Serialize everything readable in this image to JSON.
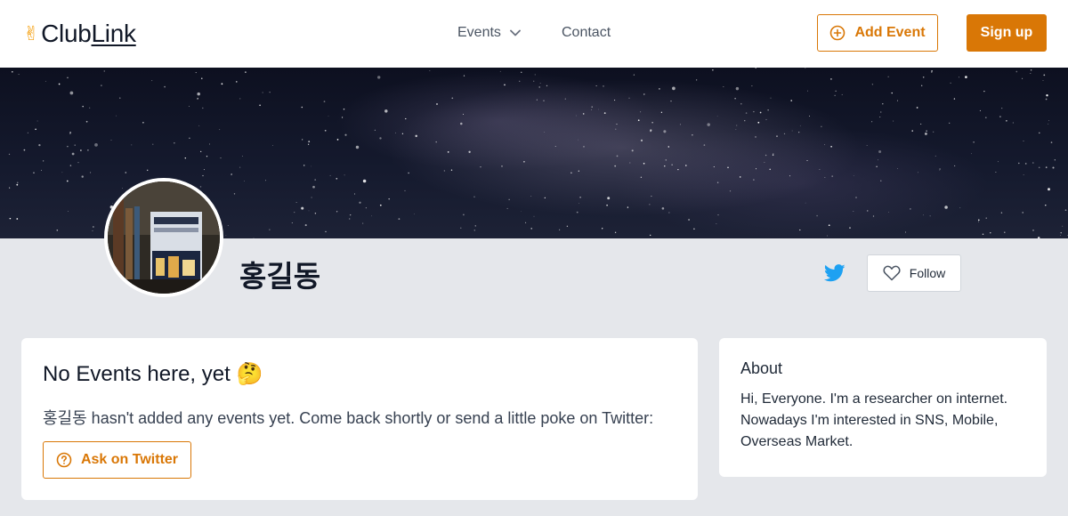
{
  "header": {
    "logo_emoji": "✌",
    "logo_text_a": "Club",
    "logo_text_b": "Link",
    "nav": {
      "events_label": "Events",
      "contact_label": "Contact"
    },
    "add_event_label": "Add Event",
    "sign_up_label": "Sign up"
  },
  "profile": {
    "name": "홍길동",
    "follow_label": "Follow"
  },
  "events_card": {
    "title": "No Events here, yet 🤔",
    "description": "홍길동 hasn't added any events yet. Come back shortly or send a little poke on Twitter:",
    "ask_label": "Ask on Twitter"
  },
  "about_card": {
    "title": "About",
    "text": "Hi, Everyone. I'm a researcher on internet. Nowadays I'm interested in SNS, Mobile, Overseas Market."
  },
  "colors": {
    "accent": "#d97706",
    "twitter": "#1da1f2",
    "page_bg": "#e5e7eb"
  },
  "icons": {
    "add_event": "plus-circle-icon",
    "events_menu": "chevron-down-icon",
    "twitter": "twitter-icon",
    "follow": "heart-icon",
    "ask": "question-circle-icon"
  }
}
